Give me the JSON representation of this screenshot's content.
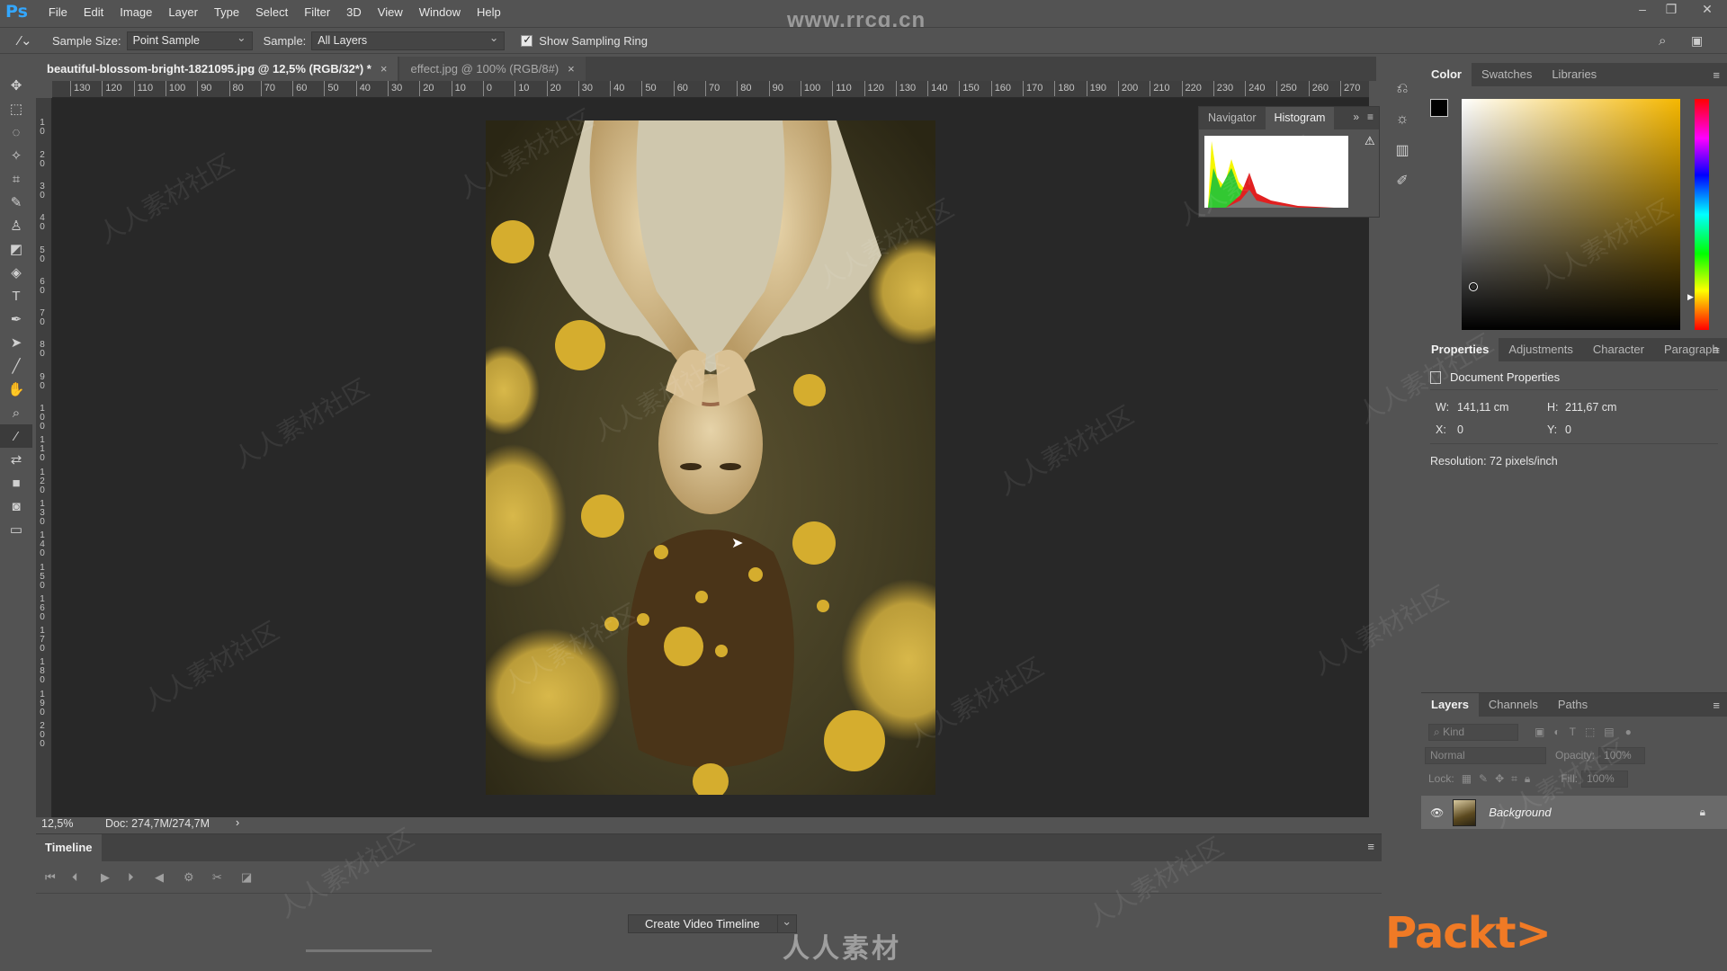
{
  "app": {
    "logo": "Ps",
    "menu": [
      "File",
      "Edit",
      "Image",
      "Layer",
      "Type",
      "Select",
      "Filter",
      "3D",
      "View",
      "Window",
      "Help"
    ],
    "watermark_url": "www.rrcg.cn",
    "window_controls": [
      "–",
      "❐",
      "✕"
    ]
  },
  "options": {
    "sample_size_label": "Sample Size:",
    "sample_size_value": "Point Sample",
    "sample_label": "Sample:",
    "sample_value": "All Layers",
    "show_sampling_ring_label": "Show Sampling Ring",
    "show_sampling_ring_checked": true
  },
  "tools": [
    {
      "name": "move-tool",
      "glyph": "✥"
    },
    {
      "name": "marquee-tool",
      "glyph": "⬚"
    },
    {
      "name": "lasso-tool",
      "glyph": "◌"
    },
    {
      "name": "magic-wand-tool",
      "glyph": "✧"
    },
    {
      "name": "crop-tool",
      "glyph": "⌗"
    },
    {
      "name": "brush-tool",
      "glyph": "✎"
    },
    {
      "name": "clone-stamp-tool",
      "glyph": "♙"
    },
    {
      "name": "eraser-tool",
      "glyph": "◩"
    },
    {
      "name": "paint-bucket-tool",
      "glyph": "◈"
    },
    {
      "name": "type-tool",
      "glyph": "T"
    },
    {
      "name": "pen-tool",
      "glyph": "✒"
    },
    {
      "name": "path-selection-tool",
      "glyph": "➤"
    },
    {
      "name": "line-tool",
      "glyph": "╱"
    },
    {
      "name": "hand-tool",
      "glyph": "✋"
    },
    {
      "name": "zoom-tool",
      "glyph": "⌕"
    },
    {
      "name": "eyedropper-tool",
      "glyph": "⁄"
    },
    {
      "name": "swap-colors-tool",
      "glyph": "⇄"
    },
    {
      "name": "color-swatches",
      "glyph": "■"
    },
    {
      "name": "quick-mask-tool",
      "glyph": "◙"
    },
    {
      "name": "screen-mode-tool",
      "glyph": "▭"
    }
  ],
  "document_tabs": [
    {
      "label": "beautiful-blossom-bright-1821095.jpg @ 12,5% (RGB/32*) *",
      "active": true
    },
    {
      "label": "effect.jpg @ 100% (RGB/8#)",
      "active": false
    }
  ],
  "tab_close": "×",
  "ruler_h": [
    "130",
    "120",
    "110",
    "100",
    "90",
    "80",
    "70",
    "60",
    "50",
    "40",
    "30",
    "20",
    "10",
    "0",
    "10",
    "20",
    "30",
    "40",
    "50",
    "60",
    "70",
    "80",
    "90",
    "100",
    "110",
    "120",
    "130",
    "140",
    "150",
    "160",
    "170",
    "180",
    "190",
    "200",
    "210",
    "220",
    "230",
    "240",
    "250",
    "260",
    "270"
  ],
  "ruler_v": [
    "0",
    "10",
    "20",
    "30",
    "40",
    "50",
    "60",
    "70",
    "80",
    "90",
    "100",
    "110",
    "120",
    "130",
    "140",
    "150",
    "160",
    "170",
    "180",
    "190",
    "200"
  ],
  "histogram_panel": {
    "tabs": [
      "Navigator",
      "Histogram"
    ],
    "active_tab": "Histogram",
    "warning_glyph": "⚠"
  },
  "status": {
    "zoom": "12,5%",
    "doc": "Doc: 274,7M/274,7M",
    "arrow": "›"
  },
  "timeline": {
    "title": "Timeline",
    "controls": [
      "⏮",
      "⏴",
      "▶",
      "⏵",
      "◀",
      "⚙",
      "✂",
      "◪"
    ],
    "create_button": "Create Video Timeline"
  },
  "color_panel": {
    "tabs": [
      "Color",
      "Swatches",
      "Libraries"
    ],
    "active_tab": "Color"
  },
  "properties_panel": {
    "tabs": [
      "Properties",
      "Adjustments",
      "Character",
      "Paragraph"
    ],
    "active_tab": "Properties",
    "title": "Document Properties",
    "w_label": "W:",
    "w_value": "141,11 cm",
    "h_label": "H:",
    "h_value": "211,67 cm",
    "x_label": "X:",
    "x_value": "0",
    "y_label": "Y:",
    "y_value": "0",
    "resolution": "Resolution: 72 pixels/inch"
  },
  "layers_panel": {
    "tabs": [
      "Layers",
      "Channels",
      "Paths"
    ],
    "active_tab": "Layers",
    "kind_placeholder": "Kind",
    "blend_mode": "Normal",
    "opacity_label": "Opacity:",
    "opacity_value": "100%",
    "lock_label": "Lock:",
    "fill_label": "Fill:",
    "fill_value": "100%",
    "layer_name": "Background"
  },
  "branding": {
    "packt": "Packt>",
    "cn_watermark": "人人素材",
    "diag_watermark": "人人素材社区"
  }
}
